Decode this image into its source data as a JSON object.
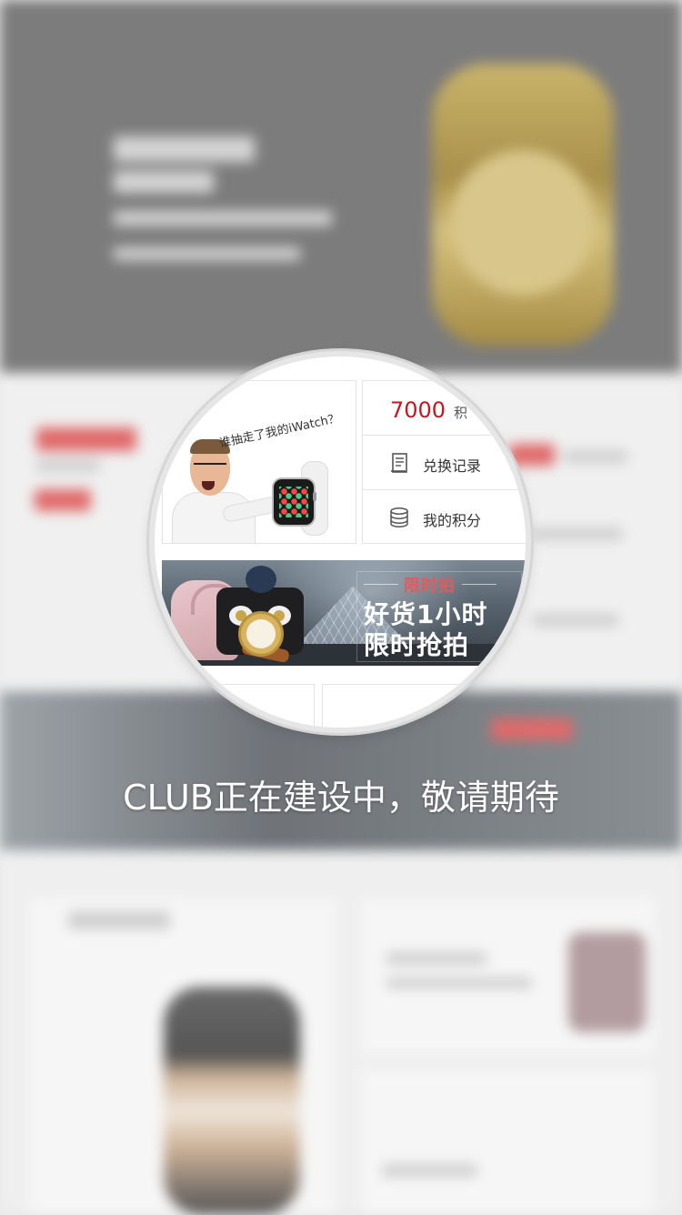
{
  "promo": {
    "caption": "谁抽走了我的iWatch？"
  },
  "points": {
    "value": "7000",
    "unit_partial": "积"
  },
  "menu": {
    "exchange_record": "兑换记录",
    "my_points": "我的积分"
  },
  "sale_banner": {
    "tag": "限时拍",
    "line1": "好货1小时",
    "line2": "限时抢拍"
  },
  "overlay": {
    "message": "CLUB正在建设中，敬请期待"
  },
  "colors": {
    "accent_red": "#c8161d",
    "sale_tag_red": "#e35a5a"
  },
  "icons": {
    "exchange_record": "receipt-icon",
    "my_points": "coin-stack-icon"
  }
}
